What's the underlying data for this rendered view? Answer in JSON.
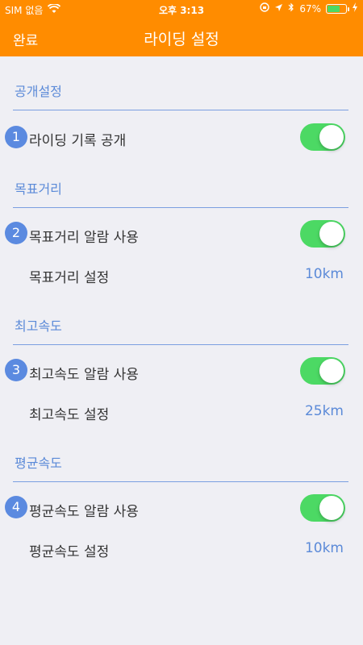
{
  "status_bar": {
    "carrier": "SIM 없음",
    "time": "오후 3:13",
    "battery": "67%",
    "battery_level": 0.67,
    "icons": [
      "wifi-icon",
      "orientation-lock-icon",
      "location-icon",
      "bluetooth-icon",
      "battery-icon",
      "charging-icon"
    ]
  },
  "navbar": {
    "left_button": "완료",
    "title": "라이딩 설정"
  },
  "sections": [
    {
      "title": "공개설정",
      "rows": [
        {
          "badge": "1",
          "label": "라이딩 기록 공개",
          "toggle_on": true
        }
      ]
    },
    {
      "title": "목표거리",
      "rows": [
        {
          "badge": "2",
          "label": "목표거리 알람 사용",
          "toggle_on": true
        },
        {
          "label": "목표거리 설정",
          "value": "10km"
        }
      ]
    },
    {
      "title": "최고속도",
      "rows": [
        {
          "badge": "3",
          "label": "최고속도 알람 사용",
          "toggle_on": true
        },
        {
          "label": "최고속도 설정",
          "value": "25km"
        }
      ]
    },
    {
      "title": "평균속도",
      "rows": [
        {
          "badge": "4",
          "label": "평균속도 알람 사용",
          "toggle_on": true
        },
        {
          "label": "평균속도 설정",
          "value": "10km"
        }
      ]
    }
  ],
  "colors": {
    "header": "#ff8c00",
    "accent": "#5b8ad8",
    "toggle_on": "#4cd964",
    "background": "#efeff4"
  }
}
